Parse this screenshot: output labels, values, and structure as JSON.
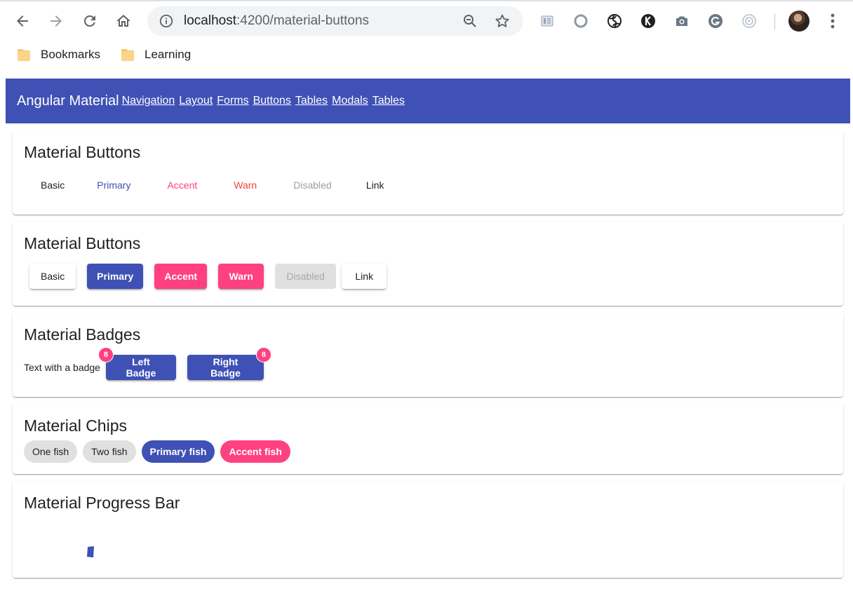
{
  "browser": {
    "url_host": "localhost",
    "url_rest": ":4200/material-buttons",
    "bookmarks": [
      "Bookmarks",
      "Learning"
    ]
  },
  "app": {
    "title": "Angular Material",
    "nav": [
      "Navigation",
      "Layout",
      "Forms",
      "Buttons",
      "Tables",
      "Modals",
      "Tables"
    ],
    "color": "#3f51b5"
  },
  "flat_buttons": {
    "title": "Material Buttons",
    "buttons": [
      {
        "label": "Basic",
        "color": "#212121"
      },
      {
        "label": "Primary",
        "color": "#3f51b5"
      },
      {
        "label": "Accent",
        "color": "#ff4081"
      },
      {
        "label": "Warn",
        "color": "#f44336"
      },
      {
        "label": "Disabled",
        "color": "#9e9e9e"
      },
      {
        "label": "Link",
        "color": "#212121"
      }
    ]
  },
  "raised_buttons": {
    "title": "Material Buttons",
    "buttons": [
      {
        "label": "Basic"
      },
      {
        "label": "Primary"
      },
      {
        "label": "Accent"
      },
      {
        "label": "Warn"
      },
      {
        "label": "Disabled"
      },
      {
        "label": "Link"
      }
    ]
  },
  "badges": {
    "title": "Material Badges",
    "text": "Text with a badge",
    "left_button": "Left Badge",
    "right_button": "Right Badge",
    "left_count": "8",
    "right_count": "8"
  },
  "chips": {
    "title": "Material Chips",
    "items": [
      "One fish",
      "Two fish",
      "Primary fish",
      "Accent fish"
    ]
  },
  "progress": {
    "title": "Material Progress Bar"
  },
  "colors": {
    "primary": "#3f51b5",
    "accent": "#ff4081",
    "warn": "#f44336"
  }
}
